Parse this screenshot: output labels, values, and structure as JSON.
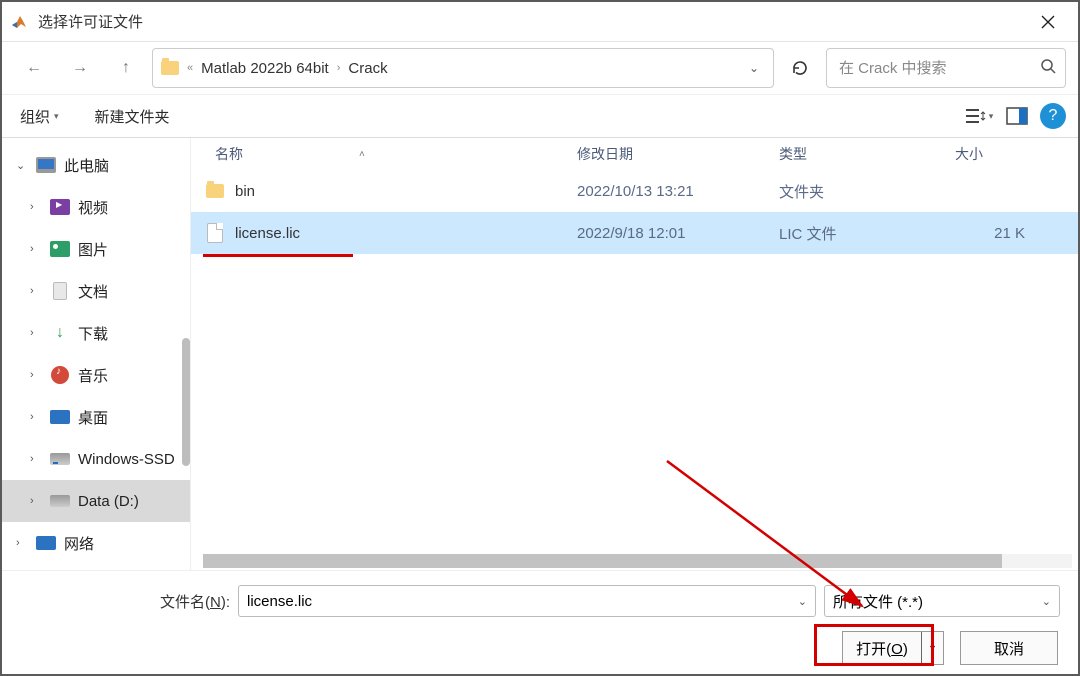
{
  "title": "选择许可证文件",
  "path": {
    "seg1": "Matlab 2022b 64bit",
    "seg2": "Crack"
  },
  "search": {
    "placeholder": "在 Crack 中搜索"
  },
  "toolbar": {
    "organize": "组织",
    "newfolder": "新建文件夹"
  },
  "columns": {
    "name": "名称",
    "date": "修改日期",
    "type": "类型",
    "size": "大小"
  },
  "sidebar": {
    "pc": "此电脑",
    "video": "视频",
    "pictures": "图片",
    "documents": "文档",
    "downloads": "下载",
    "music": "音乐",
    "desktop": "桌面",
    "win": "Windows-SSD",
    "data": "Data (D:)",
    "network": "网络"
  },
  "files": [
    {
      "name": "bin",
      "date": "2022/10/13 13:21",
      "type": "文件夹",
      "size": ""
    },
    {
      "name": "license.lic",
      "date": "2022/9/18 12:01",
      "type": "LIC 文件",
      "size": "21 K"
    }
  ],
  "footer": {
    "filename_label_pre": "文件名(",
    "filename_label_u": "N",
    "filename_label_post": "):",
    "filename_value": "license.lic",
    "filetype": "所有文件 (*.*)",
    "open_pre": "打开(",
    "open_u": "O",
    "open_post": ")",
    "cancel": "取消"
  }
}
